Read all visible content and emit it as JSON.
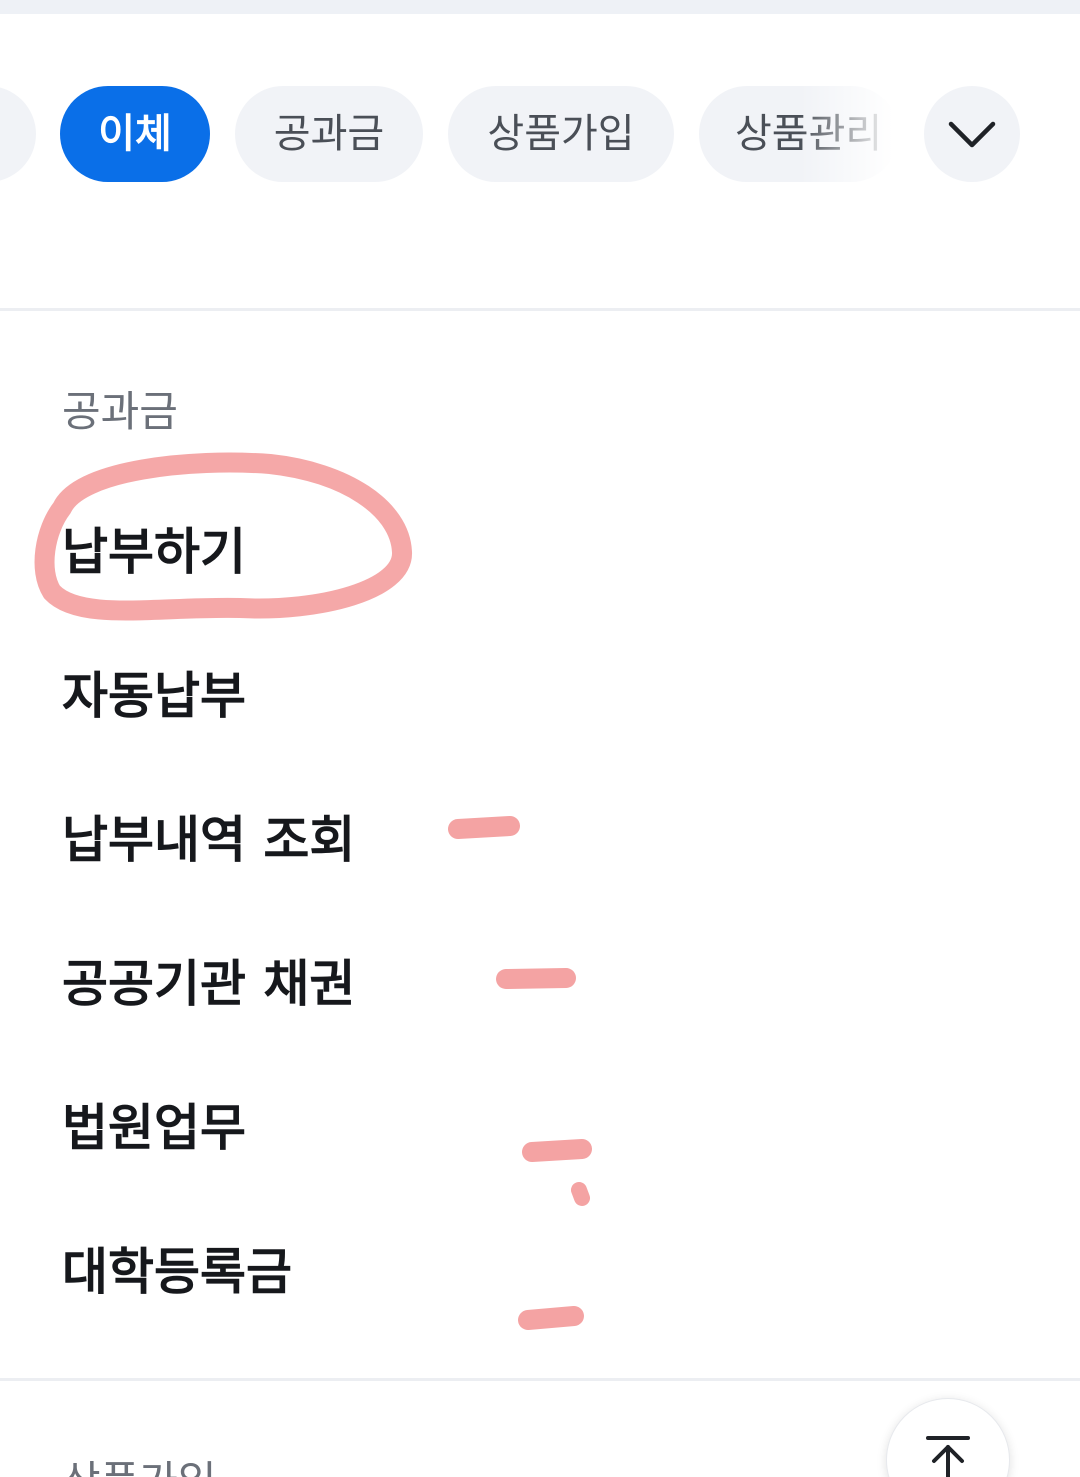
{
  "tabs": {
    "items": [
      {
        "label": ""
      },
      {
        "label": "이체",
        "active": true
      },
      {
        "label": "공과금"
      },
      {
        "label": "상품가입"
      },
      {
        "label": "상품관리"
      }
    ],
    "expand_icon": "chevron-down-icon",
    "active_color": "#0a6fe8"
  },
  "utilities_section": {
    "title": "공과금",
    "items": [
      {
        "label": "납부하기"
      },
      {
        "label": "자동납부"
      },
      {
        "label": "납부내역 조회"
      },
      {
        "label": "공공기관 채권"
      },
      {
        "label": "법원업무"
      },
      {
        "label": "대학등록금"
      }
    ]
  },
  "next_section": {
    "title": "상품가입"
  },
  "scroll_top_icon": "arrow-up-to-top-icon",
  "annotation_color": "#f4a3a3"
}
